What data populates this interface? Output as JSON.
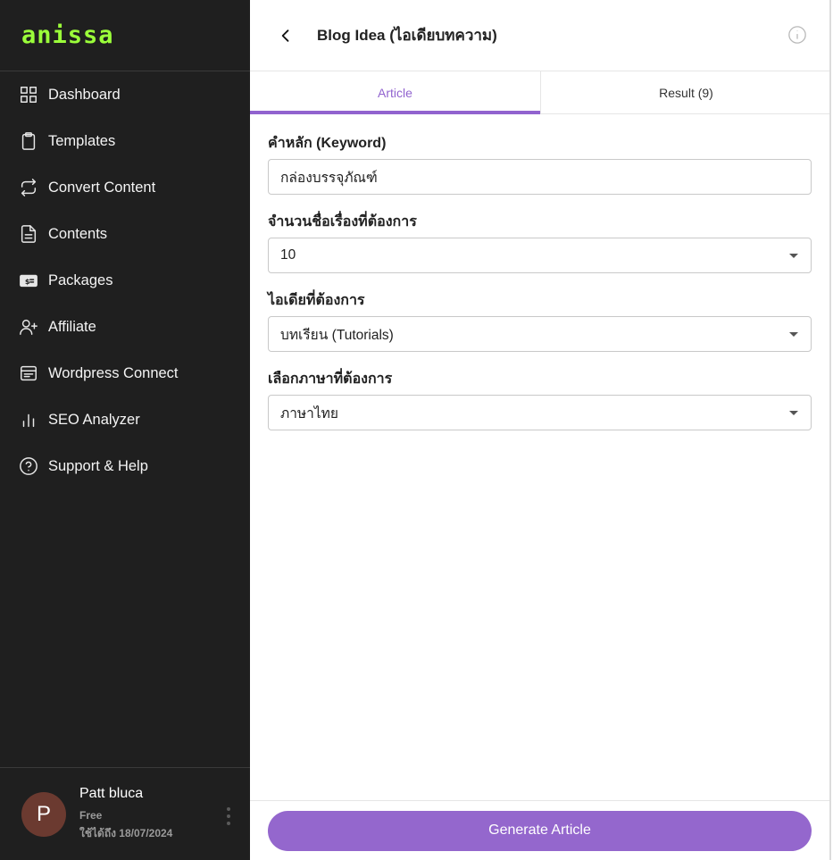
{
  "brand": {
    "name": "anissa",
    "color": "#9bff3a"
  },
  "sidebar": {
    "items": [
      {
        "label": "Dashboard",
        "icon": "grid-icon"
      },
      {
        "label": "Templates",
        "icon": "clipboard-icon"
      },
      {
        "label": "Convert Content",
        "icon": "repeat-icon"
      },
      {
        "label": "Contents",
        "icon": "document-icon"
      },
      {
        "label": "Packages",
        "icon": "money-icon"
      },
      {
        "label": "Affiliate",
        "icon": "user-plus-icon"
      },
      {
        "label": "Wordpress Connect",
        "icon": "window-icon"
      },
      {
        "label": "SEO Analyzer",
        "icon": "bar-chart-icon"
      },
      {
        "label": "Support & Help",
        "icon": "help-circle-icon"
      }
    ]
  },
  "user": {
    "initial": "P",
    "name": "Patt bluca",
    "plan": "Free",
    "expiry": "ใช้ได้ถึง 18/07/2024"
  },
  "header": {
    "title": "Blog Idea (ไอเดียบทความ)"
  },
  "tabs": [
    {
      "label": "Article",
      "active": true
    },
    {
      "label": "Result (9)",
      "active": false
    }
  ],
  "form": {
    "keyword": {
      "label": "คำหลัก (Keyword)",
      "value": "กล่องบรรจุภัณฑ์"
    },
    "count": {
      "label": "จำนวนชื่อเรื่องที่ต้องการ",
      "value": "10"
    },
    "idea": {
      "label": "ไอเดียที่ต้องการ",
      "value": "บทเรียน (Tutorials)"
    },
    "language": {
      "label": "เลือกภาษาที่ต้องการ",
      "value": "ภาษาไทย"
    }
  },
  "footer": {
    "button_label": "Generate Article",
    "accent": "#9467cd"
  }
}
